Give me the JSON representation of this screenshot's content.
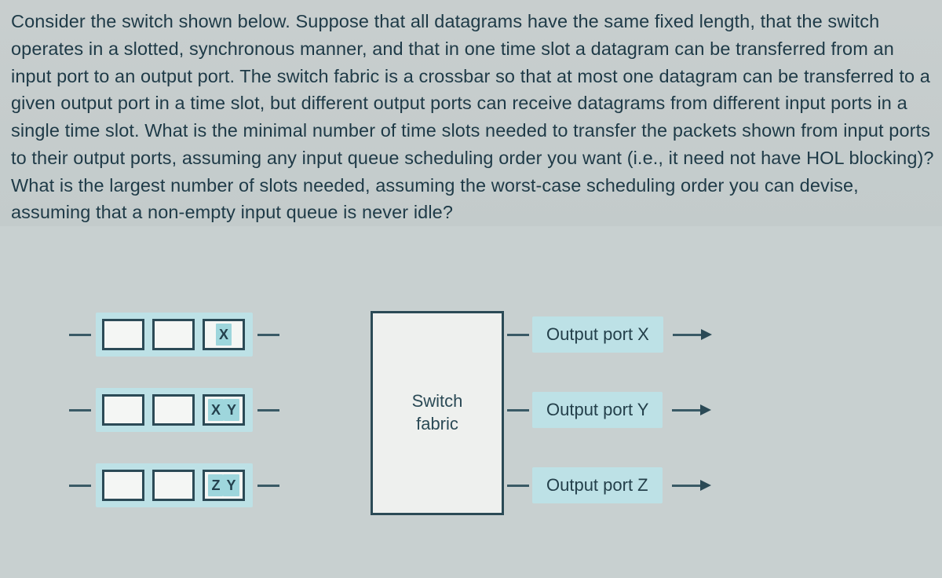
{
  "question": "Consider the switch shown below. Suppose that all datagrams have the same fixed length, that the switch operates in a slotted, synchronous manner, and that in one time slot a datagram can be transferred from an input port to an output port. The switch fabric is a crossbar so that at most one datagram can be transferred to a given output port in a time slot, but different output ports can receive datagrams from different input ports in a single time slot. What is the minimal number of time slots needed to transfer the packets shown from input ports to their output ports, assuming any input queue scheduling order you want (i.e., it need not have HOL blocking)? What is the largest number of slots needed, assuming the worst-case scheduling order you can devise, assuming that a non-empty input queue is never idle?",
  "fabric": {
    "line1": "Switch",
    "line2": "fabric"
  },
  "inputs": [
    {
      "slots": [
        "",
        "",
        "X"
      ]
    },
    {
      "slots": [
        "",
        "",
        "X Y"
      ]
    },
    {
      "slots": [
        "",
        "",
        "Z Y"
      ]
    }
  ],
  "input_packets": {
    "row1_slot3": [
      "X"
    ],
    "row2_slot3": [
      "X",
      "Y"
    ],
    "row3_slot3": [
      "Z",
      "Y"
    ]
  },
  "outputs": [
    {
      "label": "Output port X"
    },
    {
      "label": "Output port Y"
    },
    {
      "label": "Output port Z"
    }
  ]
}
